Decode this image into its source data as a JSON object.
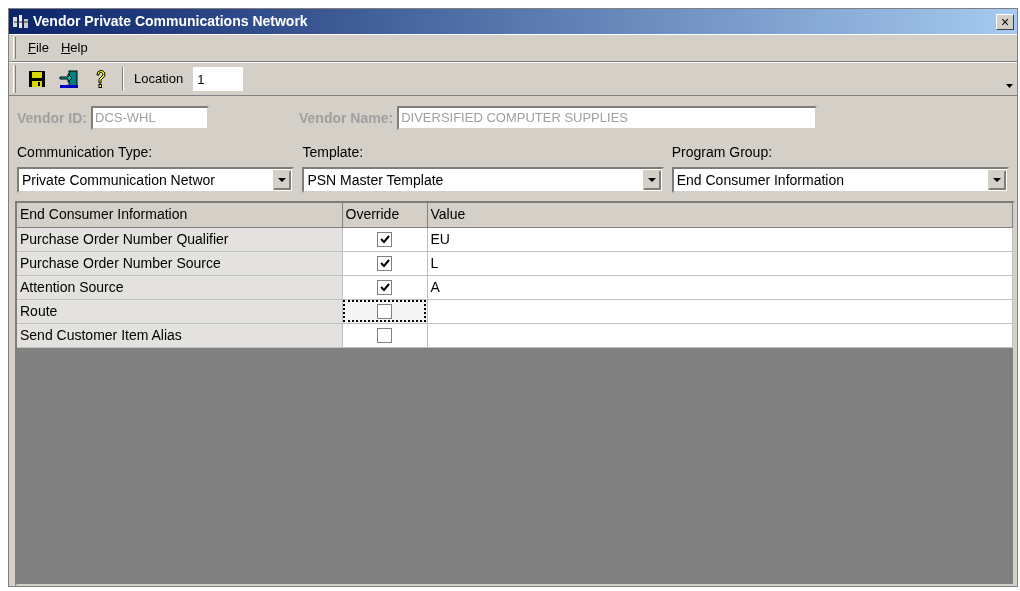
{
  "window": {
    "title": "Vendor Private Communications Network",
    "close": "×"
  },
  "menu": [
    {
      "label": "File"
    },
    {
      "label": "Help"
    }
  ],
  "toolbar": {
    "location_label": "Location",
    "location_value": "1"
  },
  "vendor": {
    "id_label": "Vendor ID:",
    "id_value": "DCS-WHL",
    "name_label": "Vendor Name:",
    "name_value": "DIVERSIFIED COMPUTER SUPPLIES",
    "disabled": true
  },
  "selectors": [
    {
      "label": "Communication Type:",
      "value": "Private Communication Networ"
    },
    {
      "label": "Template:",
      "value": "PSN Master Template"
    },
    {
      "label": "Program Group:",
      "value": "End Consumer Information"
    }
  ],
  "grid": {
    "columns": [
      "End Consumer Information",
      "Override",
      "Value"
    ],
    "rows": [
      {
        "name": "Purchase Order Number Qualifier",
        "override": true,
        "value": "EU",
        "focused": false
      },
      {
        "name": "Purchase Order Number Source",
        "override": true,
        "value": "L",
        "focused": false
      },
      {
        "name": "Attention Source",
        "override": true,
        "value": "A",
        "focused": false
      },
      {
        "name": "Route",
        "override": false,
        "focused": true
      },
      {
        "name": "Send Customer Item Alias",
        "override": false,
        "focused": false
      }
    ]
  }
}
